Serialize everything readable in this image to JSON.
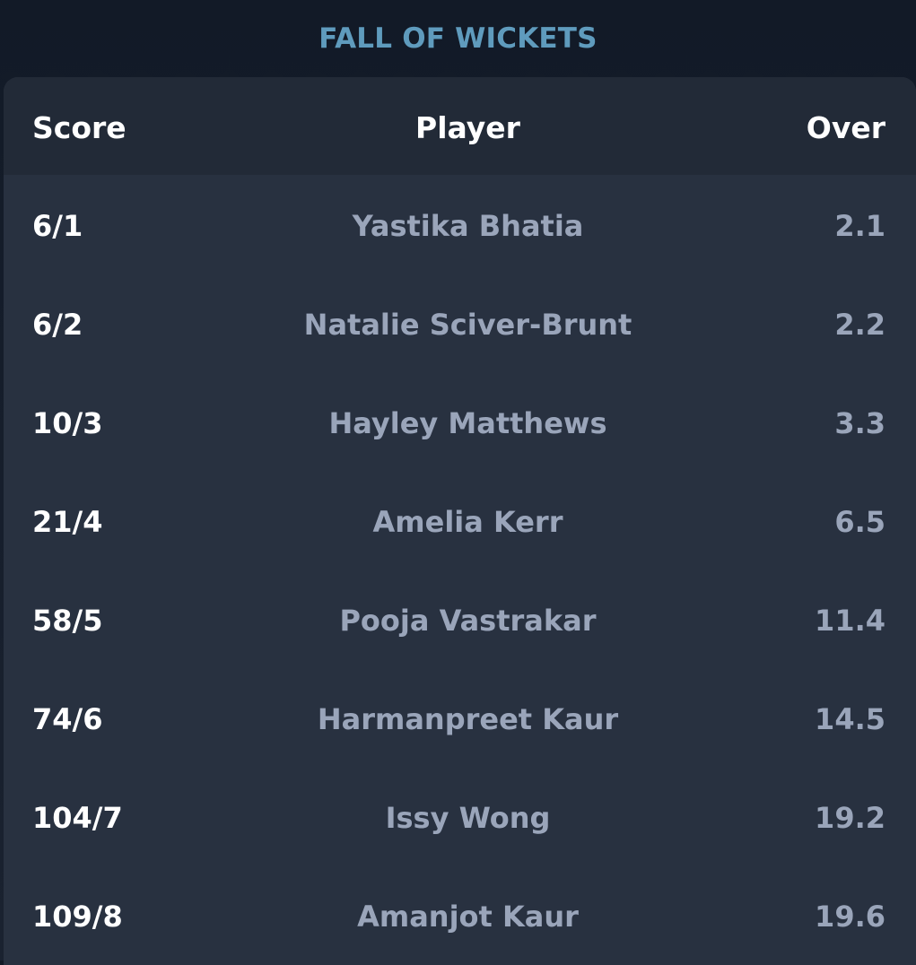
{
  "title": "FALL OF WICKETS",
  "columns": {
    "score": "Score",
    "player": "Player",
    "over": "Over"
  },
  "rows": [
    {
      "score": "6/1",
      "player": "Yastika Bhatia",
      "over": "2.1"
    },
    {
      "score": "6/2",
      "player": "Natalie Sciver-Brunt",
      "over": "2.2"
    },
    {
      "score": "10/3",
      "player": "Hayley Matthews",
      "over": "3.3"
    },
    {
      "score": "21/4",
      "player": "Amelia Kerr",
      "over": "6.5"
    },
    {
      "score": "58/5",
      "player": "Pooja Vastrakar",
      "over": "11.4"
    },
    {
      "score": "74/6",
      "player": "Harmanpreet Kaur",
      "over": "14.5"
    },
    {
      "score": "104/7",
      "player": "Issy Wong",
      "over": "19.2"
    },
    {
      "score": "109/8",
      "player": "Amanjot Kaur",
      "over": "19.6"
    }
  ],
  "colors": {
    "title": "#5f9bbd",
    "card": "#283140",
    "header": "#222a37",
    "muted_text": "#9aa5ba"
  }
}
